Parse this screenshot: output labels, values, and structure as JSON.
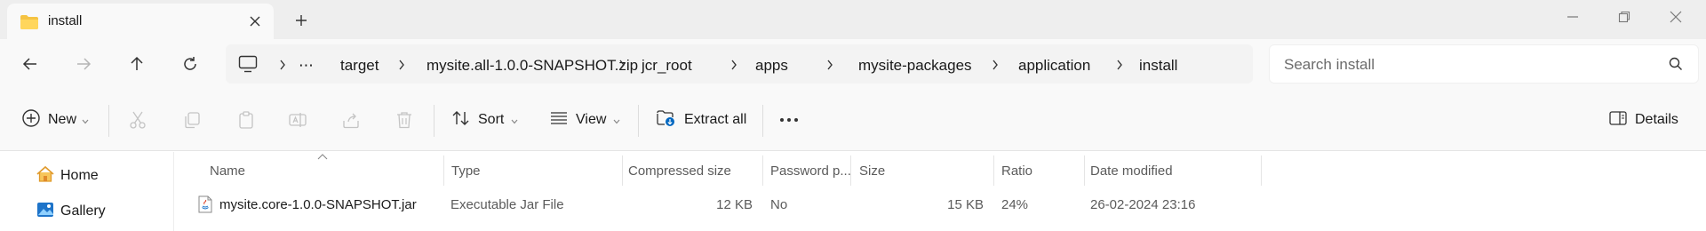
{
  "window": {
    "tab_title": "install",
    "tab_icon": "folder-icon",
    "accent_color": "#0067c0",
    "folder_color": "#f5c342"
  },
  "address": {
    "breadcrumb": [
      "target",
      "mysite.all-1.0.0-SNAPSHOT.zip",
      "jcr_root",
      "apps",
      "mysite-packages",
      "application",
      "install"
    ],
    "overflow": "⋯"
  },
  "search": {
    "placeholder": "Search install"
  },
  "toolbar": {
    "new_label": "New",
    "sort_label": "Sort",
    "view_label": "View",
    "extract_label": "Extract all",
    "details_label": "Details"
  },
  "nav": {
    "items": [
      {
        "label": "Home",
        "icon": "home-icon"
      },
      {
        "label": "Gallery",
        "icon": "gallery-icon"
      }
    ]
  },
  "table": {
    "columns": [
      "Name",
      "Type",
      "Compressed size",
      "Password p...",
      "Size",
      "Ratio",
      "Date modified"
    ],
    "rows": [
      {
        "name": "mysite.core-1.0.0-SNAPSHOT.jar",
        "type": "Executable Jar File",
        "compressed_size": "12 KB",
        "password": "No",
        "size": "15 KB",
        "ratio": "24%",
        "date_modified": "26-02-2024 23:16",
        "icon": "jar-file-icon"
      }
    ]
  }
}
